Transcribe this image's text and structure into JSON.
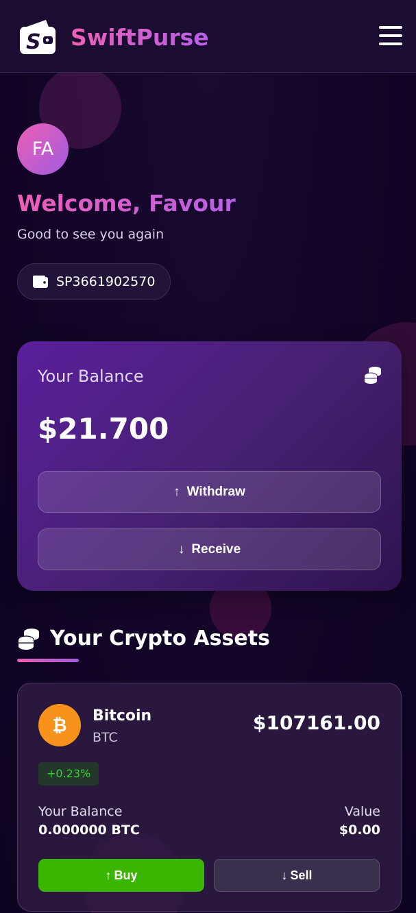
{
  "header": {
    "brand": "SwiftPurse",
    "logo_icon": "wallet-logo-icon",
    "menu_icon": "hamburger-menu-icon"
  },
  "profile": {
    "initials": "FA",
    "welcome": "Welcome, Favour",
    "subtitle": "Good to see you again",
    "account_number": "SP3661902570",
    "account_icon": "wallet-icon"
  },
  "balance": {
    "label": "Your Balance",
    "amount": "$21.700",
    "icon": "coins-icon",
    "withdraw_label": "Withdraw",
    "receive_label": "Receive"
  },
  "assets": {
    "title": "Your Crypto Assets",
    "icon": "coins-stack-icon",
    "items": [
      {
        "name": "Bitcoin",
        "symbol": "BTC",
        "icon_glyph": "₿",
        "price": "$107161.00",
        "change": "+0.23%",
        "balance_label": "Your Balance",
        "balance_value": "0.000000 BTC",
        "value_label": "Value",
        "value": "$0.00",
        "buy_label": "Buy",
        "sell_label": "Sell"
      }
    ]
  },
  "colors": {
    "accent_pink": "#ee5fb5",
    "accent_purple": "#a05be0",
    "buy_green": "#3ab500",
    "bitcoin_orange": "#f7931a",
    "positive_change": "#3ecf3e"
  }
}
